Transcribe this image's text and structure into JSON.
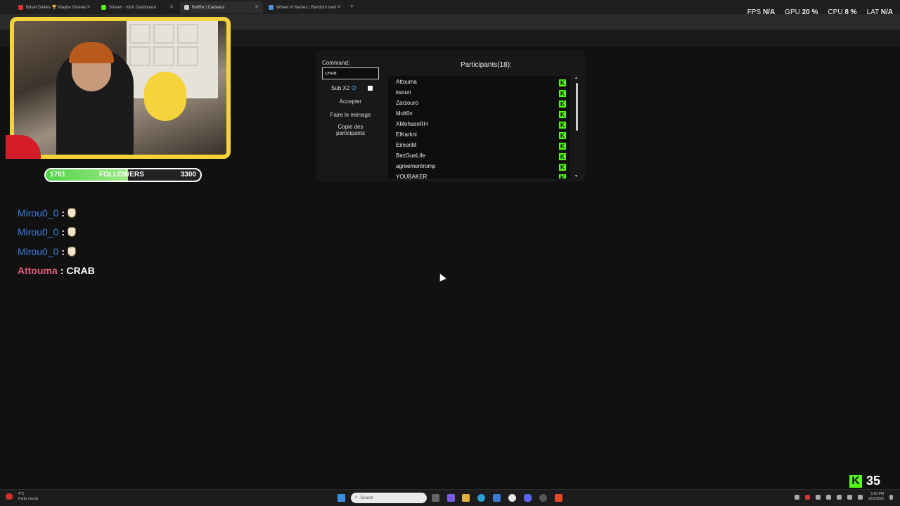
{
  "browser": {
    "tabs": [
      {
        "label": "Bduel Dailies 🏆 Maybe Giveaw",
        "favicon_color": "#e03030",
        "active": false
      },
      {
        "label": "Stream - Kick Dashboard",
        "favicon_color": "#53fc18",
        "active": false
      },
      {
        "label": "BotRix | Cadeaux",
        "favicon_color": "#cccccc",
        "active": true
      },
      {
        "label": "Wheel of Names | Random nam",
        "favicon_color": "#4a90d9",
        "active": false
      }
    ],
    "new_tab_icon": "plus-icon"
  },
  "stats": {
    "fps_label": "FPS",
    "fps_value": "N/A",
    "gpu_label": "GPU",
    "gpu_value": "20 %",
    "cpu_label": "CPU",
    "cpu_value": "8 %",
    "lat_label": "LAT",
    "lat_value": "N/A"
  },
  "followers": {
    "current": "1761",
    "label": "FOLLOWERS",
    "goal": "3300",
    "progress_fraction": 0.53
  },
  "chat": [
    {
      "user": "Mirou0_0",
      "sep": ":",
      "message": "",
      "emote": true,
      "color": "#3b7ddd"
    },
    {
      "user": "Mirou0_0",
      "sep": ":",
      "message": "",
      "emote": true,
      "color": "#3b7ddd"
    },
    {
      "user": "Mirou0_0",
      "sep": ":",
      "message": "",
      "emote": true,
      "color": "#3b7ddd"
    },
    {
      "user": "Attouma",
      "sep": ":",
      "message": "CRAB",
      "emote": false,
      "color": "#e05b7b"
    }
  ],
  "giveaway": {
    "command_label": "Command:",
    "command_value": "CRAB",
    "sub_x2_label": "Sub X2",
    "accept_label": "Accepter",
    "clean_label": "Faire le ménage",
    "copy_label": "Copie des participants",
    "participants_title": "Participants(18):",
    "participants": [
      "Attouma",
      "ksouri",
      "Zarzouro",
      "Molt0v",
      "XMohsenRH",
      "ElKarkni",
      "EimonM",
      "BezGueLife",
      "agreementromp",
      "YOUBAKER"
    ]
  },
  "viewers": {
    "count": "35"
  },
  "taskbar": {
    "weather_temp": "4°C",
    "weather_desc": "Partly cloudy",
    "search_placeholder": "Search",
    "time": "5:50 PM",
    "date": "12/2/2025"
  }
}
